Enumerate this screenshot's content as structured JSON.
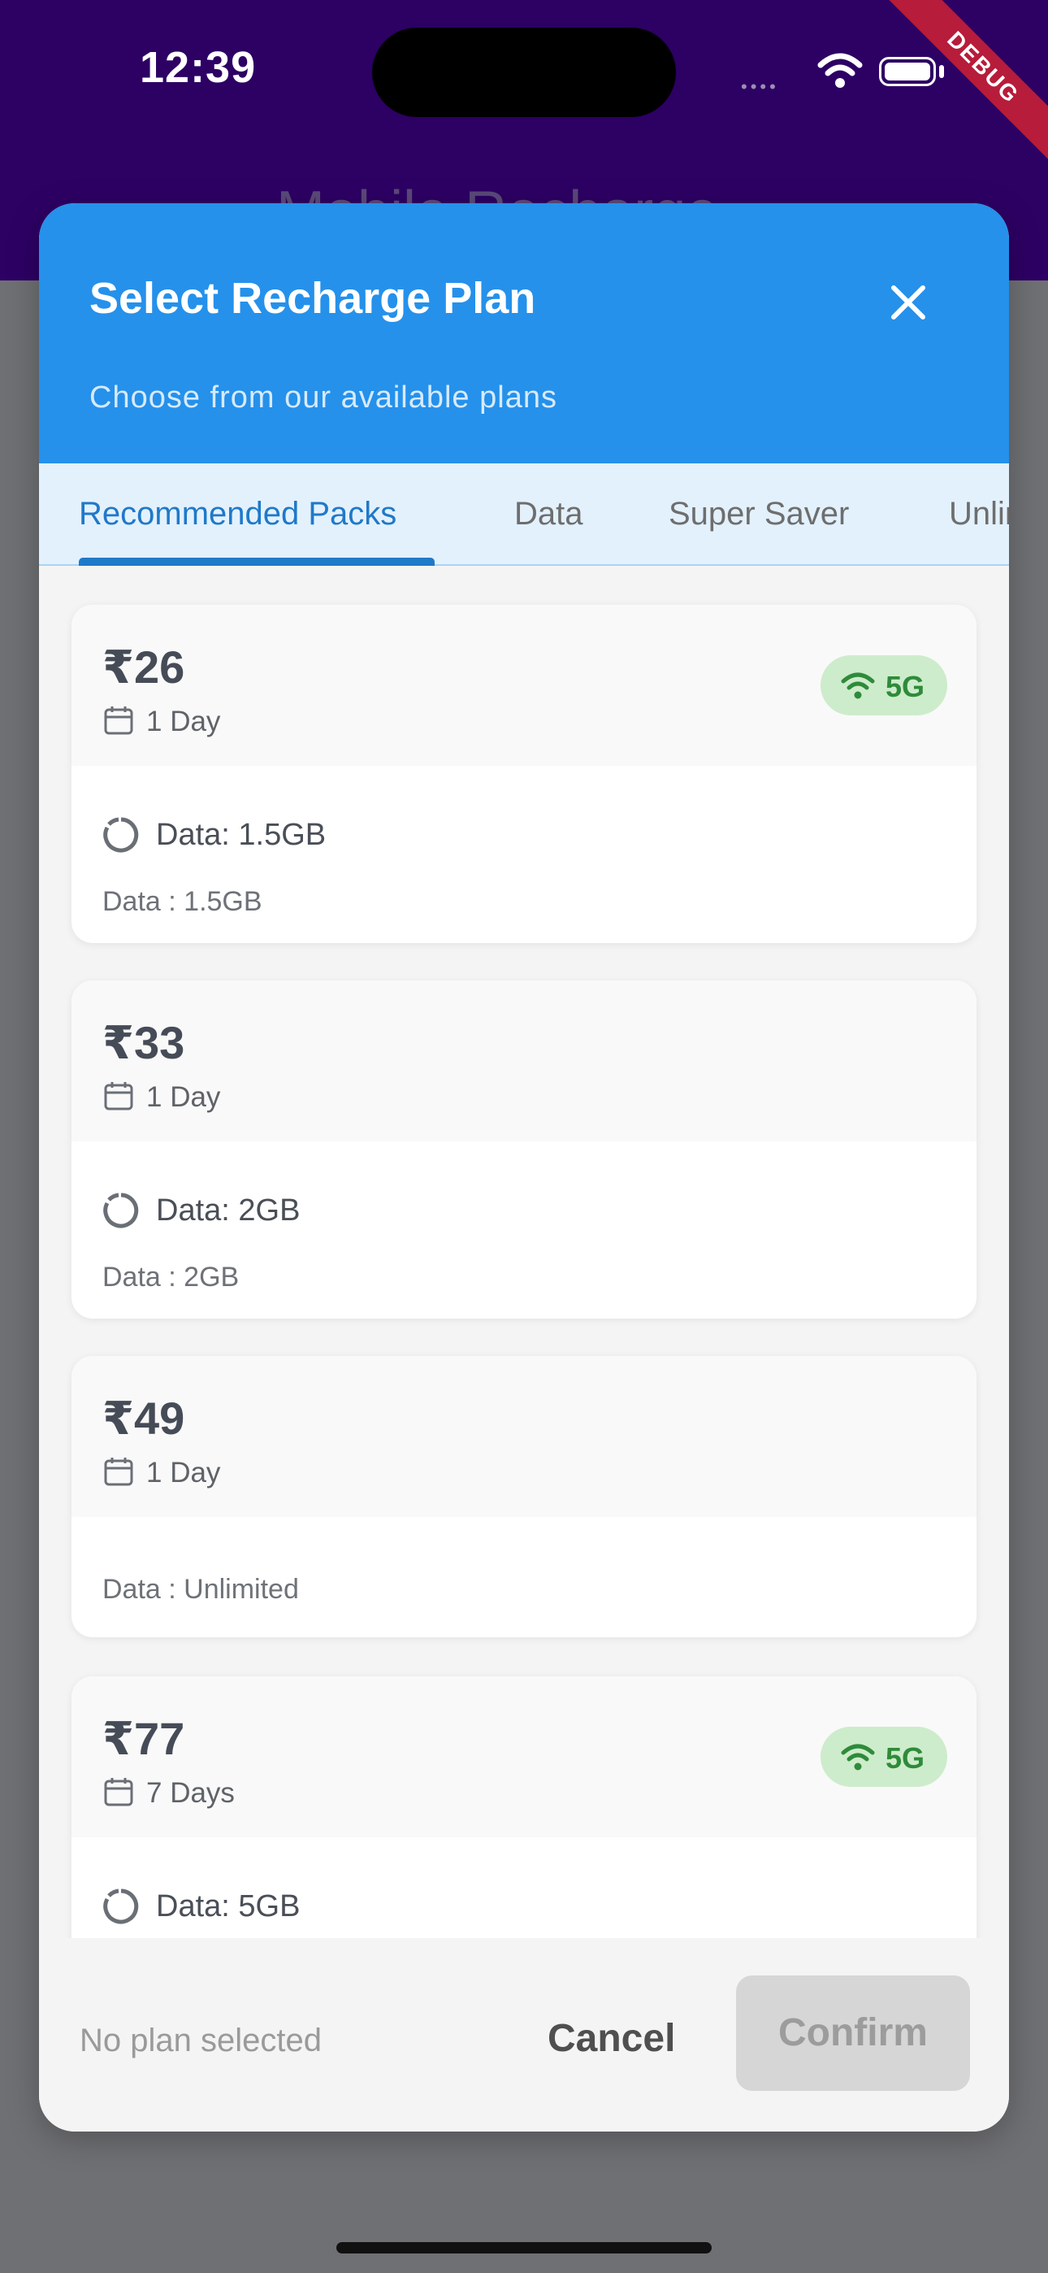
{
  "status_bar": {
    "time": "12:39",
    "debug": "DEBUG"
  },
  "background_app": {
    "back": "‹",
    "title": "Mobile Recharge"
  },
  "dialog": {
    "title": "Select Recharge Plan",
    "subtitle": "Choose from our available plans",
    "close_icon": "close-icon",
    "tabs": [
      {
        "label": "Recommended Packs",
        "active": true
      },
      {
        "label": "Data",
        "active": false
      },
      {
        "label": "Super Saver",
        "active": false
      },
      {
        "label": "Unlimited",
        "active": false
      }
    ],
    "plans": [
      {
        "price": "₹26",
        "validity": "1 Day",
        "badge": "5G",
        "data": "Data: 1.5GB",
        "desc": "Data : 1.5GB"
      },
      {
        "price": "₹33",
        "validity": "1 Day",
        "badge": "",
        "data": "Data: 2GB",
        "desc": "Data : 2GB"
      },
      {
        "price": "₹49",
        "validity": "1 Day",
        "badge": "",
        "data": "",
        "desc": "Data : Unlimited"
      },
      {
        "price": "₹77",
        "validity": "7 Days",
        "badge": "5G",
        "data": "Data: 5GB",
        "desc": ""
      }
    ],
    "footer": {
      "selection_status": "No plan selected",
      "cancel_label": "Cancel",
      "confirm_label": "Confirm"
    }
  },
  "colors": {
    "header": "#2591eb",
    "tab_active": "#1f79c9",
    "badge_bg": "#cdeccb",
    "badge_text": "#2e8b3a",
    "app_bar": "#2d0064"
  }
}
